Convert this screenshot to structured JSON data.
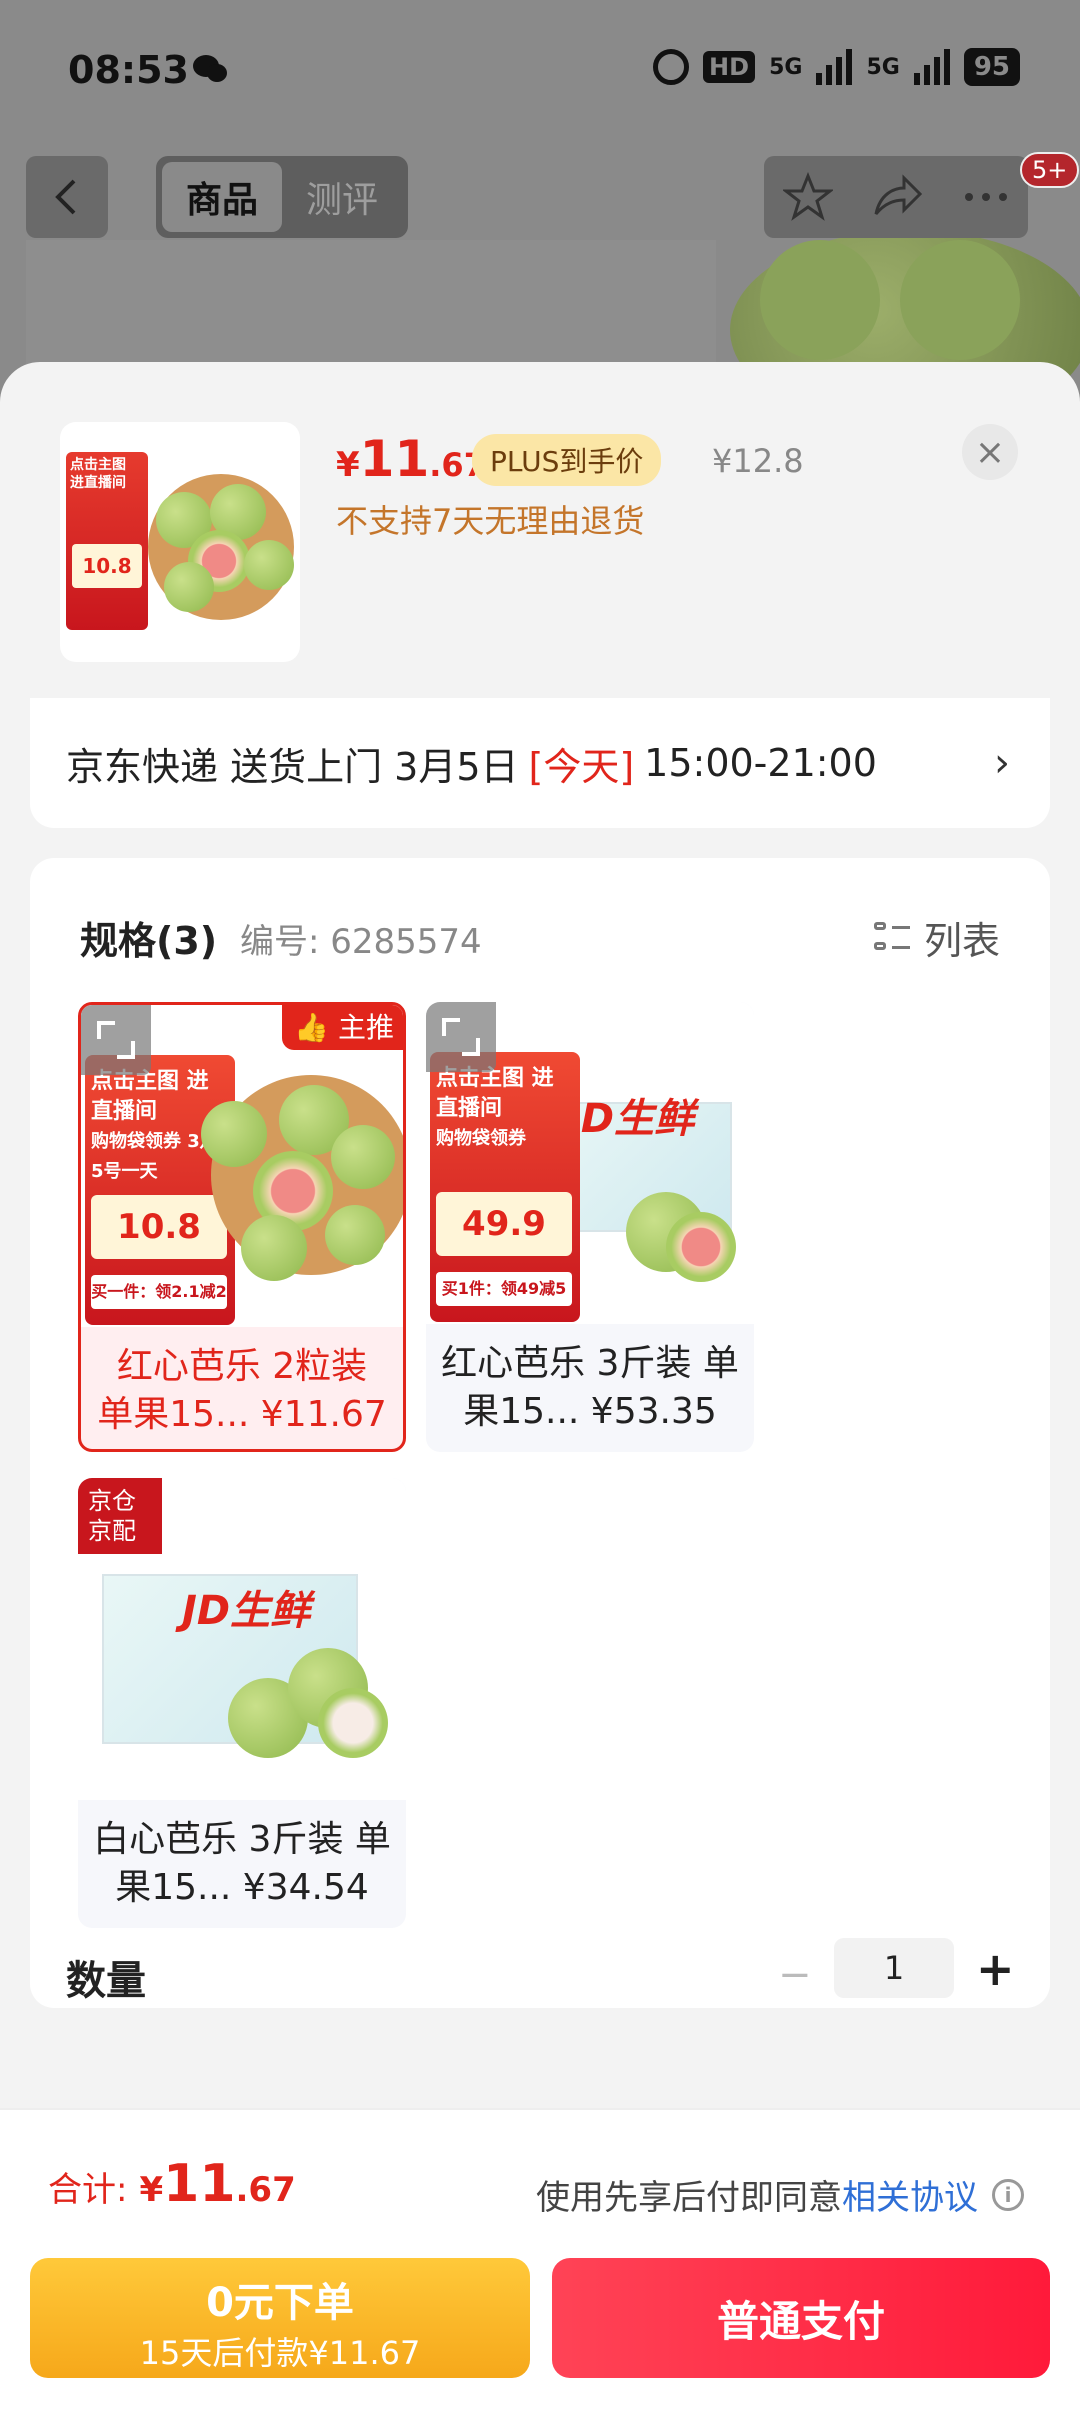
{
  "status_bar": {
    "time": "08:53",
    "hd": "HD",
    "network1": "5G",
    "network2": "5G",
    "battery": "95"
  },
  "nav": {
    "tabs": [
      {
        "label": "商品"
      },
      {
        "label": "测评"
      }
    ],
    "badge": "5+"
  },
  "product": {
    "thumb_promo_title": "点击主图 进直播间",
    "thumb_promo_price": "10.8",
    "price_yen": "¥",
    "price_int": "11",
    "price_dec": ".67",
    "plus_tag": "PLUS到手价",
    "original_price": "¥12.8",
    "return_notice": "不支持7天无理由退货",
    "close_label": "×"
  },
  "delivery": {
    "text_before": "京东快递 送货上门 3月5日",
    "today": "[今天]",
    "time": "15:00-21:00",
    "chevron": "›"
  },
  "spec": {
    "title": "规格(3)",
    "code": "编号: 6285574",
    "list_label": "列表",
    "items": [
      {
        "label": "红心芭乐 2粒装 单果15... ¥11.67",
        "tag": "主推",
        "promo_title": "点击主图 进直播间",
        "promo_sub": "购物袋领券 3月5号一天",
        "promo_price": "10.8",
        "promo_foot": "买一件：领2.1减2"
      },
      {
        "label": "红心芭乐 3斤装 单果15... ¥53.35",
        "promo_title": "点击主图 进直播间",
        "promo_sub": "购物袋领券",
        "promo_price": "49.9",
        "promo_foot": "买1件：领49减5",
        "logo": "JD生鲜"
      },
      {
        "label": "白心芭乐 3斤装 单果15... ¥34.54",
        "jd_tag": "京仓京配",
        "logo": "JD生鲜"
      }
    ]
  },
  "quantity": {
    "label": "数量",
    "minus": "−",
    "value": "1",
    "plus": "+"
  },
  "footer": {
    "total_label": "合计:",
    "total_yen": "¥",
    "total_int": "11",
    "total_dec": ".67",
    "agree_text": "使用先享后付即同意",
    "agree_link": "相关协议",
    "info": "i",
    "btn_later_line1": "0元下单",
    "btn_later_line2": "15天后付款¥11.67",
    "btn_pay": "普通支付"
  }
}
